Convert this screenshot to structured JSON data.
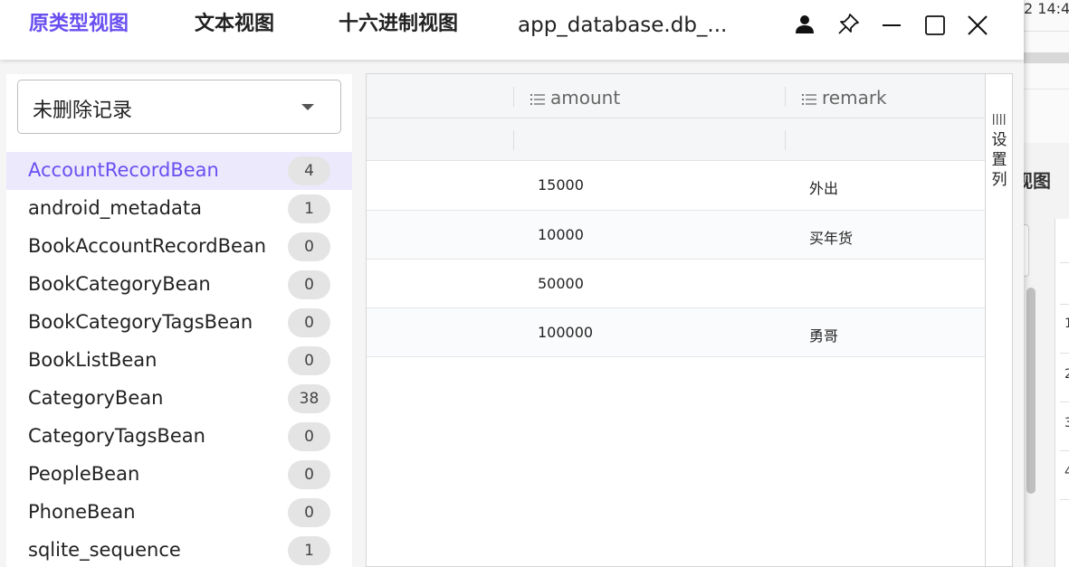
{
  "background_window": {
    "time_fragment": "2 14:4",
    "title_fragment": "视图",
    "row_numbers": [
      "1",
      "2",
      "3",
      "4"
    ]
  },
  "header": {
    "tabs": [
      {
        "label": "原类型视图",
        "active": true
      },
      {
        "label": "文本视图",
        "active": false
      },
      {
        "label": "十六进制视图",
        "active": false
      }
    ],
    "file_title": "app_database.db_...",
    "accent_color": "#6a4ff0",
    "window_controls": [
      "user-icon",
      "pin-icon",
      "minimize-icon",
      "maximize-icon",
      "close-icon"
    ]
  },
  "sidebar": {
    "filter_value": "未删除记录",
    "tables": [
      {
        "name": "AccountRecordBean",
        "count": "4",
        "selected": true
      },
      {
        "name": "android_metadata",
        "count": "1"
      },
      {
        "name": "BookAccountRecordBean",
        "count": "0"
      },
      {
        "name": "BookCategoryBean",
        "count": "0"
      },
      {
        "name": "BookCategoryTagsBean",
        "count": "0"
      },
      {
        "name": "BookListBean",
        "count": "0"
      },
      {
        "name": "CategoryBean",
        "count": "38"
      },
      {
        "name": "CategoryTagsBean",
        "count": "0"
      },
      {
        "name": "PeopleBean",
        "count": "0"
      },
      {
        "name": "PhoneBean",
        "count": "0"
      },
      {
        "name": "sqlite_sequence",
        "count": "1"
      }
    ]
  },
  "table": {
    "columns": [
      "amount",
      "remark"
    ],
    "rows": [
      {
        "amount": "15000",
        "remark": "外出"
      },
      {
        "amount": "10000",
        "remark": "买年货"
      },
      {
        "amount": "50000",
        "remark": ""
      },
      {
        "amount": "100000",
        "remark": "勇哥"
      }
    ],
    "column_settings_label": "设置列"
  }
}
